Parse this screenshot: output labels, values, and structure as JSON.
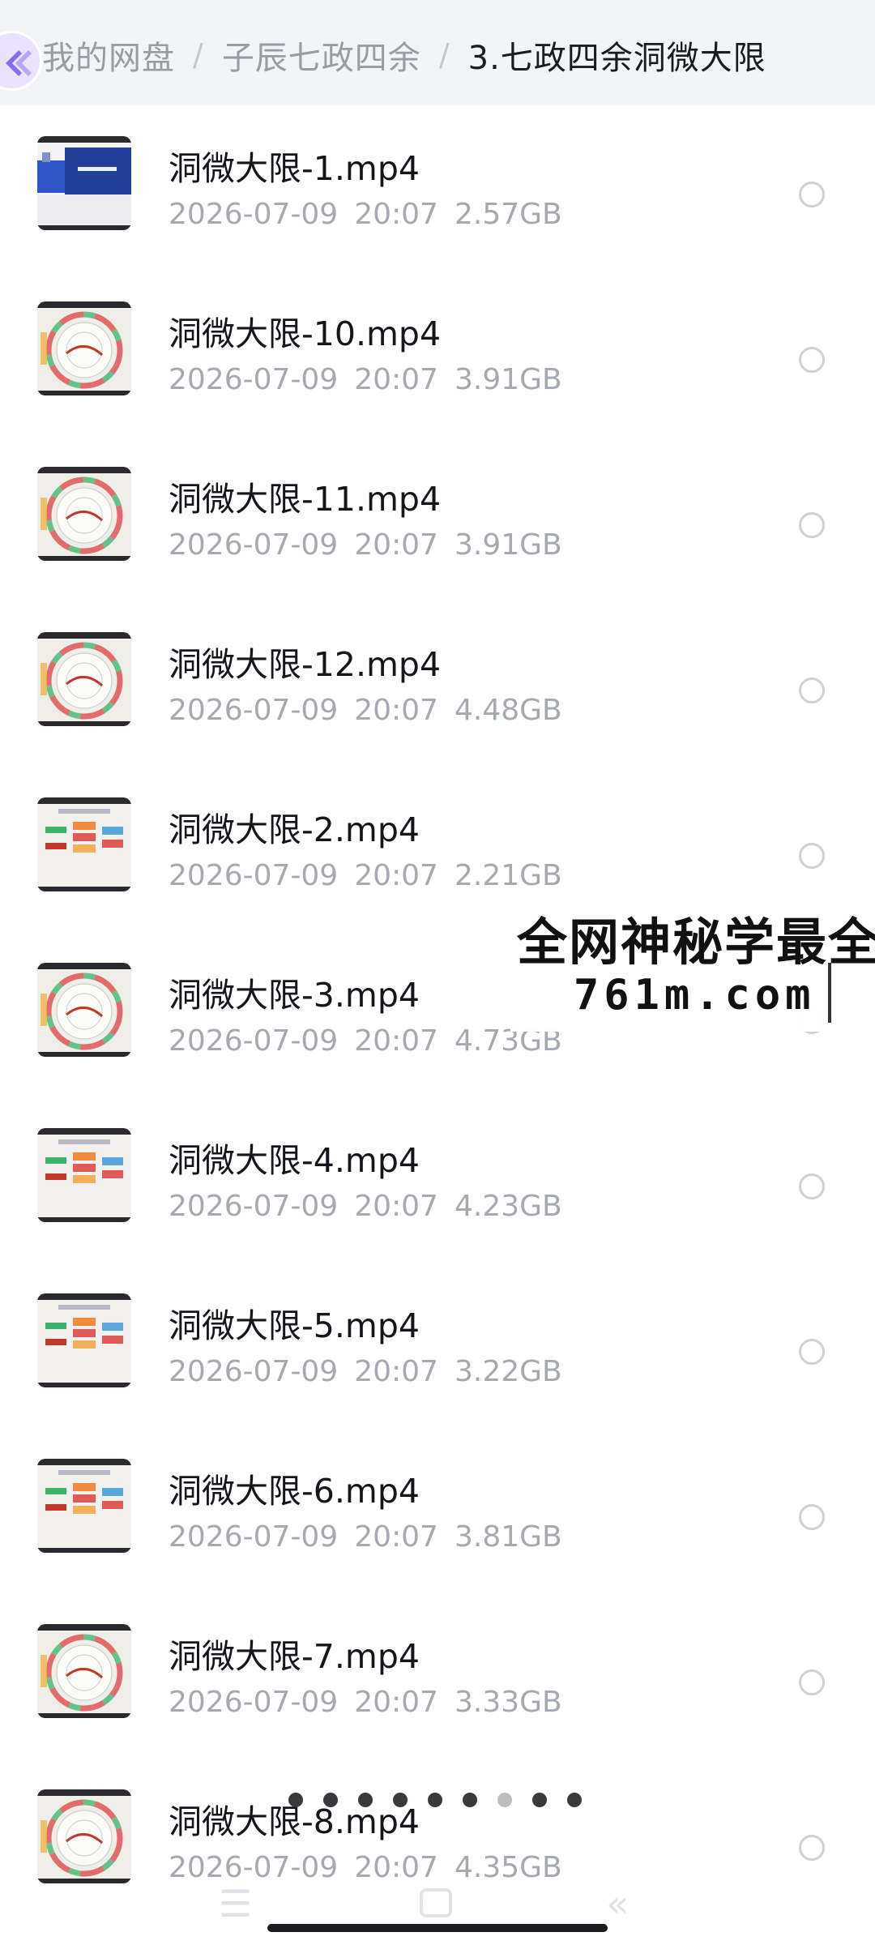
{
  "breadcrumb": {
    "items": [
      "我的网盘",
      "子辰七政四余",
      "3.七政四余洞微大限"
    ],
    "separator": "/"
  },
  "files": [
    {
      "name": "洞微大限-1.mp4",
      "date": "2026-07-09",
      "time": "20:07",
      "size": "2.57GB",
      "thumb": "title-slide"
    },
    {
      "name": "洞微大限-10.mp4",
      "date": "2026-07-09",
      "time": "20:07",
      "size": "3.91GB",
      "thumb": "wheel-chart"
    },
    {
      "name": "洞微大限-11.mp4",
      "date": "2026-07-09",
      "time": "20:07",
      "size": "3.91GB",
      "thumb": "wheel-chart"
    },
    {
      "name": "洞微大限-12.mp4",
      "date": "2026-07-09",
      "time": "20:07",
      "size": "4.48GB",
      "thumb": "wheel-chart"
    },
    {
      "name": "洞微大限-2.mp4",
      "date": "2026-07-09",
      "time": "20:07",
      "size": "2.21GB",
      "thumb": "table-slide"
    },
    {
      "name": "洞微大限-3.mp4",
      "date": "2026-07-09",
      "time": "20:07",
      "size": "4.73GB",
      "thumb": "wheel-chart"
    },
    {
      "name": "洞微大限-4.mp4",
      "date": "2026-07-09",
      "time": "20:07",
      "size": "4.23GB",
      "thumb": "table-slide"
    },
    {
      "name": "洞微大限-5.mp4",
      "date": "2026-07-09",
      "time": "20:07",
      "size": "3.22GB",
      "thumb": "table-slide"
    },
    {
      "name": "洞微大限-6.mp4",
      "date": "2026-07-09",
      "time": "20:07",
      "size": "3.81GB",
      "thumb": "table-slide"
    },
    {
      "name": "洞微大限-7.mp4",
      "date": "2026-07-09",
      "time": "20:07",
      "size": "3.33GB",
      "thumb": "wheel-chart"
    },
    {
      "name": "洞微大限-8.mp4",
      "date": "2026-07-09",
      "time": "20:07",
      "size": "4.35GB",
      "thumb": "wheel-chart"
    }
  ],
  "watermark": {
    "line1": "全网神秘学最全",
    "line2": "761m.com"
  },
  "pager": {
    "count": 9,
    "active_index": 6
  },
  "colors": {
    "header_bg": "#f3f4f8",
    "badge_purple": "#8b6cf0",
    "text_primary": "#15161b",
    "text_secondary": "#a7a9b0"
  }
}
